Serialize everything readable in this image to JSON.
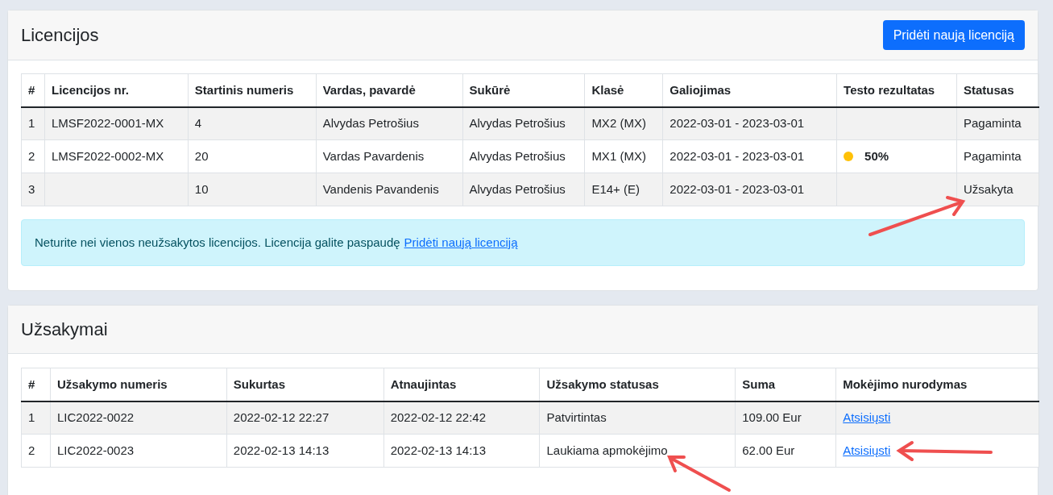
{
  "licenses": {
    "title": "Licencijos",
    "add_button": "Pridėti naują licenciją",
    "columns": [
      "#",
      "Licencijos nr.",
      "Startinis numeris",
      "Vardas, pavardė",
      "Sukūrė",
      "Klasė",
      "Galiojimas",
      "Testo rezultatas",
      "Statusas"
    ],
    "rows": [
      {
        "cells": [
          "1",
          "LMSF2022-0001-MX",
          "4",
          "Alvydas Petrošius",
          "Alvydas Petrošius",
          "MX2 (MX)",
          "2022-03-01 - 2023-03-01"
        ],
        "test_result": null,
        "status": "Pagaminta"
      },
      {
        "cells": [
          "2",
          "LMSF2022-0002-MX",
          "20",
          "Vardas Pavardenis",
          "Alvydas Petrošius",
          "MX1 (MX)",
          "2022-03-01 - 2023-03-01"
        ],
        "test_result": {
          "color": "#ffc107",
          "text": "50%"
        },
        "status": "Pagaminta"
      },
      {
        "cells": [
          "3",
          "",
          "10",
          "Vandenis Pavandenis",
          "Alvydas Petrošius",
          "E14+ (E)",
          "2022-03-01 - 2023-03-01"
        ],
        "test_result": null,
        "status": "Užsakyta"
      }
    ],
    "alert": {
      "text": "Neturite nei vienos neužsakytos licencijos. Licencija galite paspaudę",
      "link": "Pridėti naują licenciją"
    }
  },
  "orders": {
    "title": "Užsakymai",
    "columns": [
      "#",
      "Užsakymo numeris",
      "Sukurtas",
      "Atnaujintas",
      "Užsakymo statusas",
      "Suma",
      "Mokėjimo nurodymas"
    ],
    "rows": [
      {
        "cells": [
          "1",
          "LIC2022-0022",
          "2022-02-12 22:27",
          "2022-02-12 22:42",
          "Patvirtintas",
          "109.00 Eur"
        ],
        "link": "Atsisiųsti"
      },
      {
        "cells": [
          "2",
          "LIC2022-0023",
          "2022-02-13 14:13",
          "2022-02-13 14:13",
          "Laukiama apmokėjimo",
          "62.00 Eur"
        ],
        "link": "Atsisiųsti"
      }
    ]
  }
}
